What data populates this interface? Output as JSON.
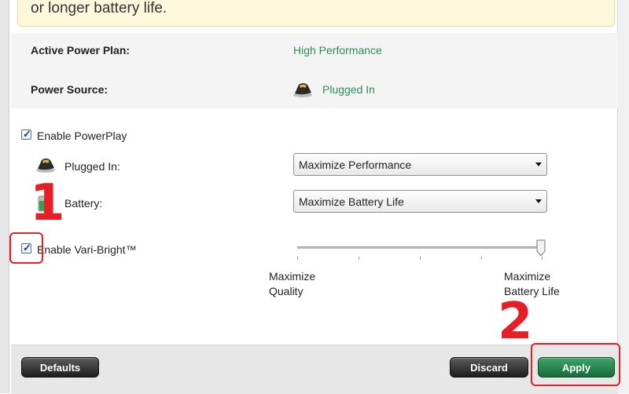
{
  "notice": {
    "text": "or longer battery life."
  },
  "info": {
    "active_plan_label": "Active Power Plan:",
    "active_plan_value": "High Performance",
    "power_source_label": "Power Source:",
    "power_source_value": "Plugged In",
    "value_color": "#2c8c52"
  },
  "powerplay": {
    "checkbox_label": "Enable PowerPlay",
    "checked": true,
    "plugged_in_label": "Plugged In:",
    "plugged_in_selected": "Maximize Performance",
    "battery_label": "Battery:",
    "battery_selected": "Maximize Battery Life"
  },
  "varibright": {
    "checkbox_label": "Enable Vari-Bright™",
    "checked": true,
    "slider_level": 1.0,
    "min_caption_line1": "Maximize",
    "min_caption_line2": "Quality",
    "max_caption_line1": "Maximize",
    "max_caption_line2": "Battery Life"
  },
  "buttons": {
    "defaults": "Defaults",
    "discard": "Discard",
    "apply": "Apply"
  },
  "annotations": {
    "step1": "1",
    "step2": "2",
    "color": "#e61f26"
  },
  "icons": {
    "power_source": "plug-icon",
    "plugged_in": "plug-icon",
    "battery": "battery-icon"
  }
}
